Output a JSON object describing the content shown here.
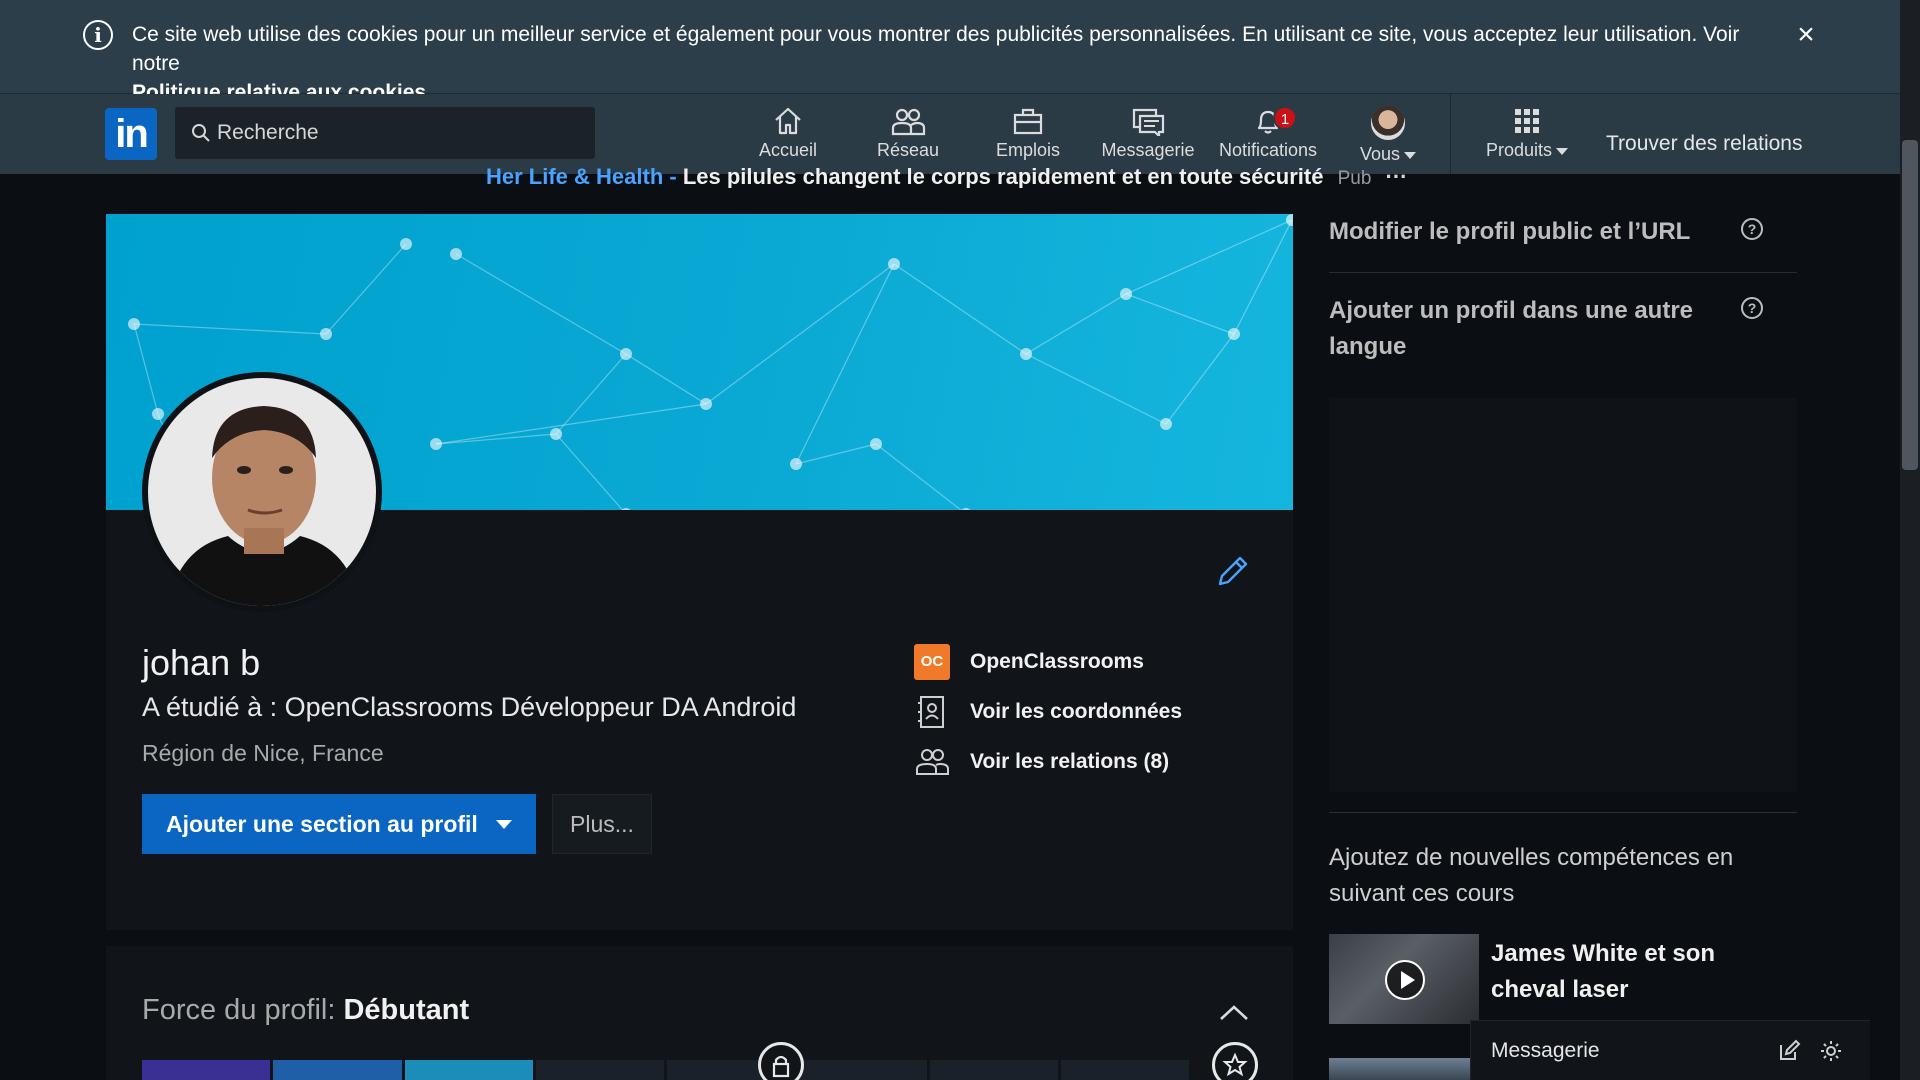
{
  "cookie_banner": {
    "message": "Ce site web utilise des cookies pour un meilleur service et également pour vous montrer des publicités personnalisées. En utilisant ce site, vous acceptez leur utilisation. Voir notre",
    "link": "Politique relative aux cookies",
    "close": "×"
  },
  "nav": {
    "search_placeholder": "Recherche",
    "items": [
      {
        "label": "Accueil",
        "icon": "home-icon"
      },
      {
        "label": "Réseau",
        "icon": "network-icon"
      },
      {
        "label": "Emplois",
        "icon": "briefcase-icon"
      },
      {
        "label": "Messagerie",
        "icon": "messaging-icon"
      },
      {
        "label": "Notifications",
        "icon": "bell-icon",
        "badge": "1"
      },
      {
        "label": "Vous",
        "icon": "avatar"
      },
      {
        "label": "Produits",
        "icon": "grid-icon"
      }
    ],
    "find": "Trouver des relations"
  },
  "ad": {
    "brand": "Her Life & Health -",
    "text": "Les pilules changent le corps rapidement et en toute sécurité",
    "pub": "Pub",
    "more": "···"
  },
  "profile": {
    "name": "johan b",
    "headline": "A étudié à : OpenClassrooms Développeur DA Android",
    "location": "Région de Nice, France",
    "add_section_button": "Ajouter une section au profil",
    "more_button": "Plus...",
    "links": [
      {
        "label": "OpenClassrooms",
        "icon": "openclassrooms-logo"
      },
      {
        "label": "Voir les coordonnées",
        "icon": "contact-card-icon"
      },
      {
        "label": "Voir les relations (8)",
        "icon": "people-icon"
      }
    ]
  },
  "strength": {
    "label": "Force du profil:",
    "level": "Débutant",
    "progress_segments_filled": 3,
    "progress_segments_total": 8
  },
  "right": {
    "edit_public_profile": "Modifier le profil public et l’URL",
    "add_language_profile": "Ajouter un profil dans une autre langue",
    "learning_heading": "Ajoutez de nouvelles compétences en suivant ces cours",
    "course_title": "James White et son cheval laser"
  },
  "dock": {
    "title": "Messagerie"
  },
  "colors": {
    "accent": "#0a66c2",
    "banner": "#00a1cf",
    "nav": "#2b3b46",
    "badge": "#cc1016"
  }
}
